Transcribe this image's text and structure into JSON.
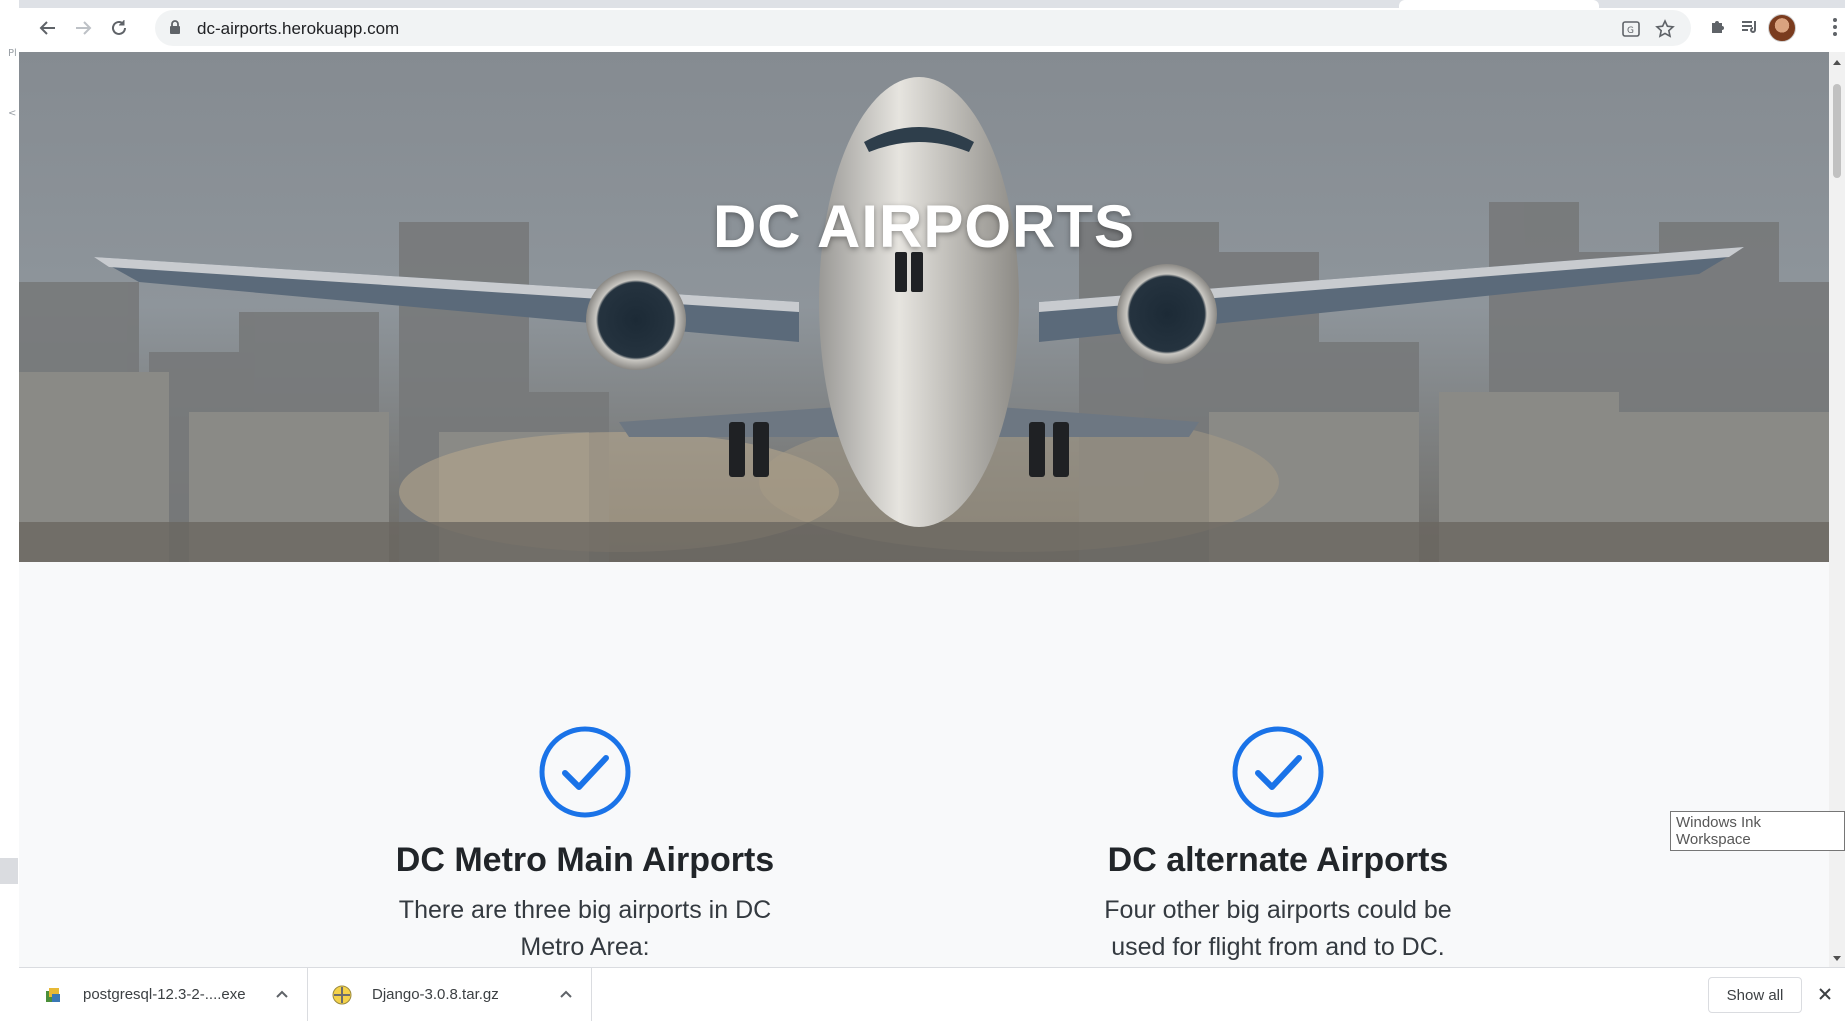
{
  "browser": {
    "url": "dc-airports.herokuapp.com",
    "left_strip_marks": [
      "Pl",
      "<"
    ]
  },
  "hero": {
    "title": "DC AIRPORTS"
  },
  "features": [
    {
      "icon": "check-circle-icon",
      "title": "DC Metro Main Airports",
      "text": "There are three big airports in DC Metro Area:"
    },
    {
      "icon": "check-circle-icon",
      "title": "DC alternate Airports",
      "text": "Four other big airports could be used for flight from and to DC."
    }
  ],
  "tooltip": "Windows Ink Workspace",
  "downloads": {
    "items": [
      {
        "name": "postgresql-12.3-2-....exe",
        "icon": "installer-icon"
      },
      {
        "name": "Django-3.0.8.tar.gz",
        "icon": "archive-icon"
      }
    ],
    "show_all": "Show all"
  },
  "colors": {
    "accent": "#1a73e8",
    "heading": "#212529",
    "page_bg": "#f8f9fa"
  }
}
